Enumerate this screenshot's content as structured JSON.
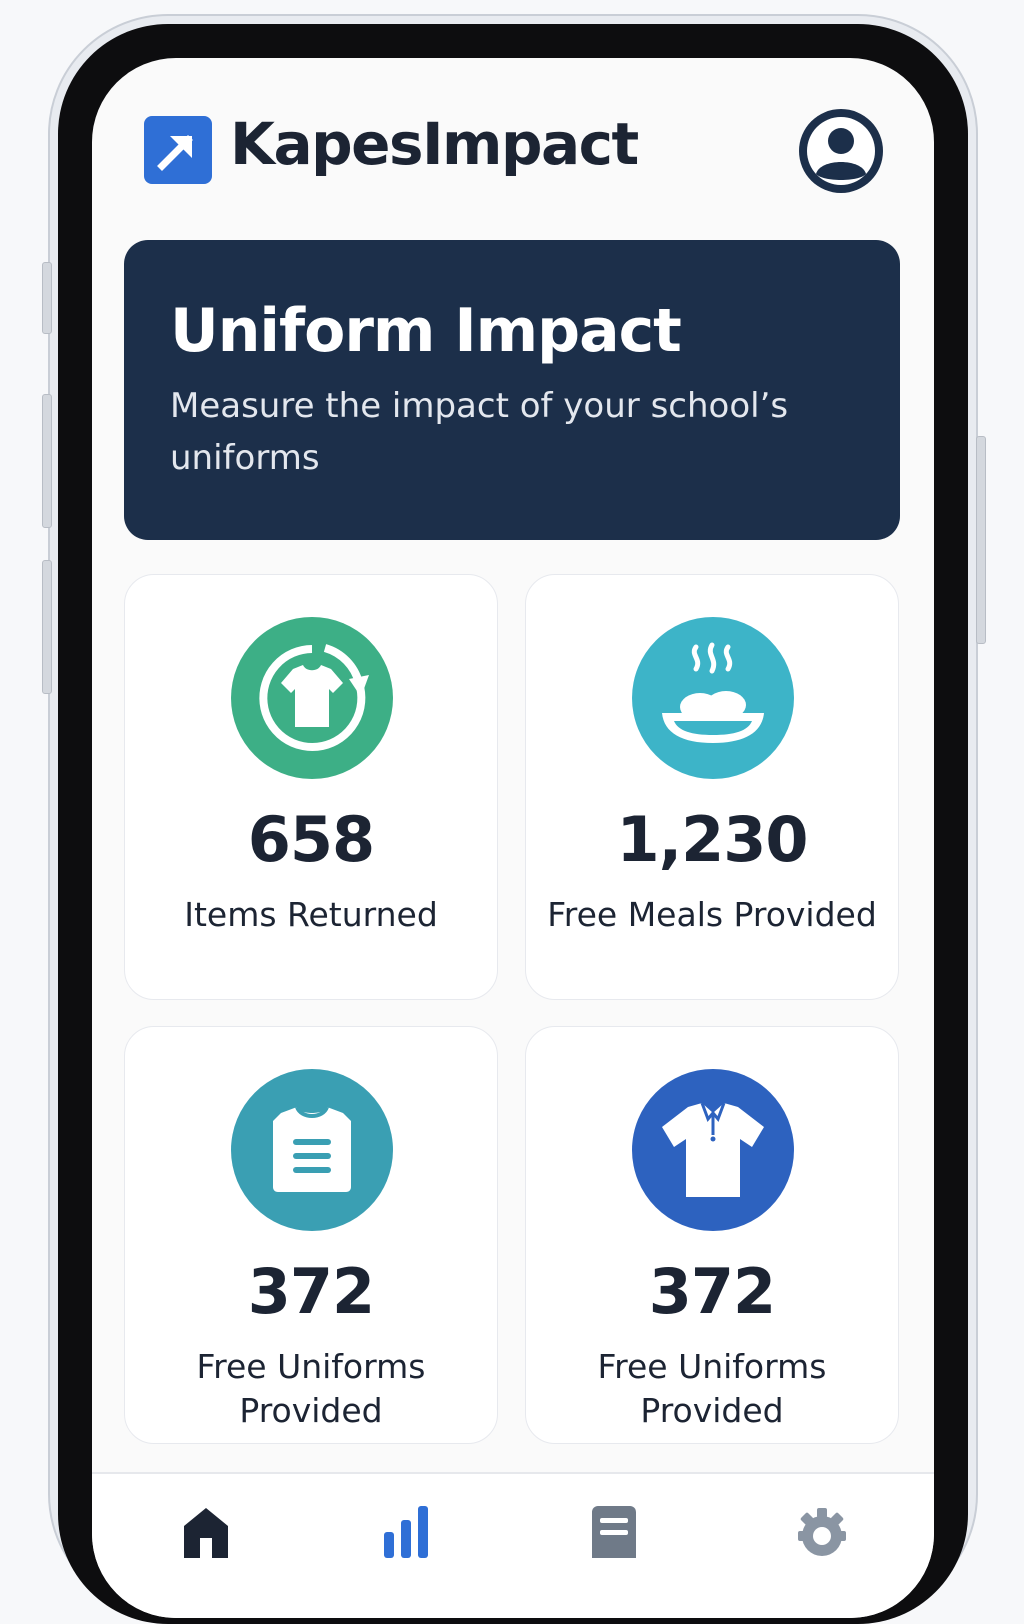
{
  "app": {
    "title": "KapesImpact"
  },
  "banner": {
    "title": "Uniform Impact",
    "subtitle": "Measure the impact of your school’s uniforms"
  },
  "stats": [
    {
      "value": "658",
      "label": "Items Returned",
      "icon": "recycle-shirt-icon",
      "color": "#3daf86"
    },
    {
      "value": "1,230",
      "label": "Free Meals Provided",
      "icon": "meal-bowl-icon",
      "color": "#3db4c8"
    },
    {
      "value": "372",
      "label": "Free Uniforms Provided",
      "icon": "clipboard-shirt-icon",
      "color": "#3a9fb3"
    },
    {
      "value": "372",
      "label": "Free Uniforms Provided",
      "icon": "polo-shirt-icon",
      "color": "#2d62bf"
    }
  ],
  "nav": {
    "items": [
      {
        "name": "home",
        "icon": "home-icon",
        "active": true
      },
      {
        "name": "stats",
        "icon": "bar-chart-icon",
        "active": false
      },
      {
        "name": "reports",
        "icon": "document-icon",
        "active": false
      },
      {
        "name": "settings",
        "icon": "gear-icon",
        "active": false
      }
    ]
  },
  "colors": {
    "brand": "#2f6fd6",
    "banner": "#1c2f4a",
    "text": "#1c2433"
  }
}
